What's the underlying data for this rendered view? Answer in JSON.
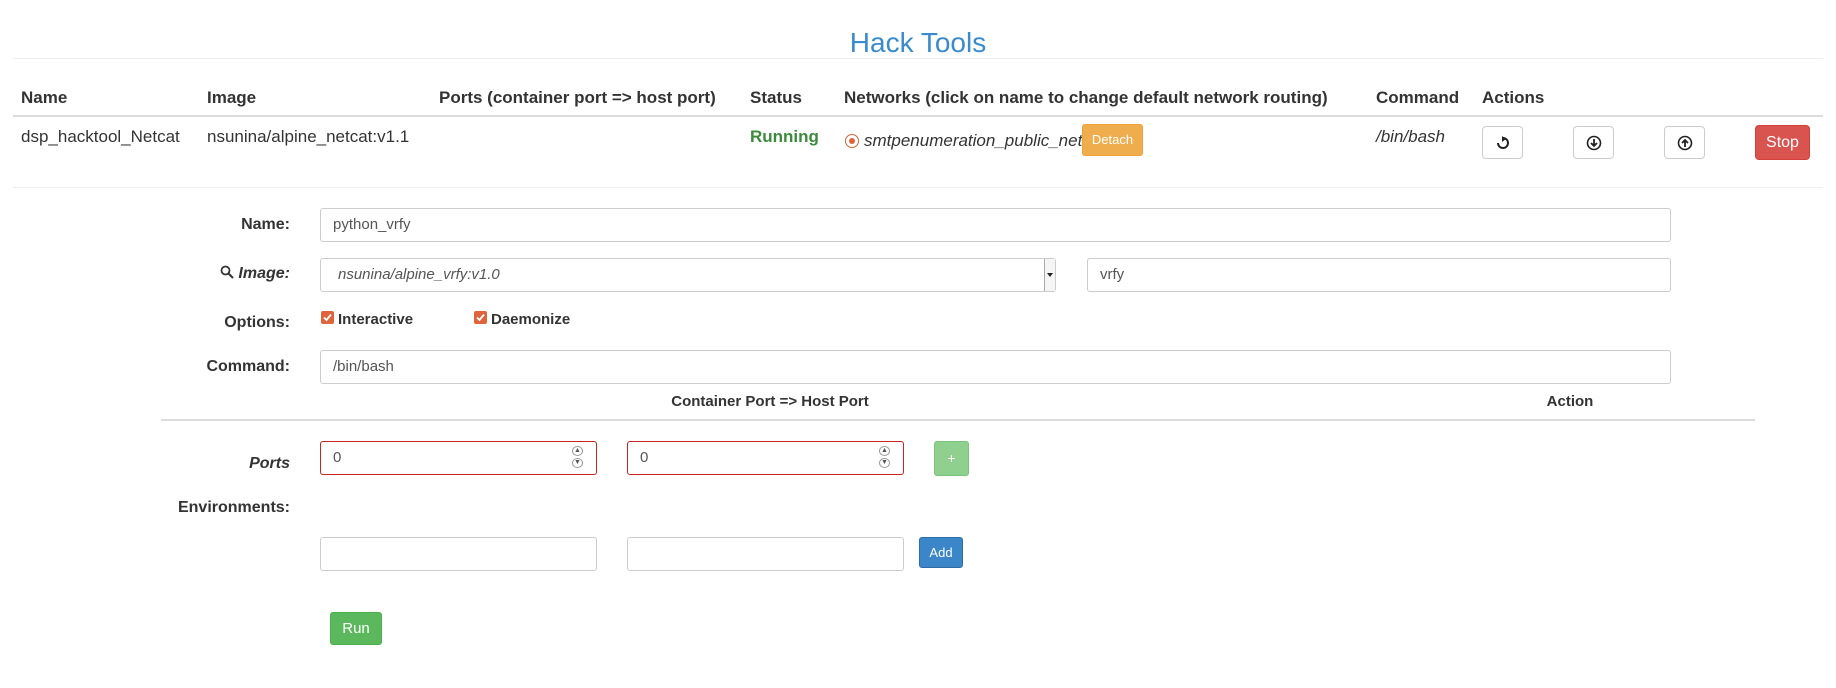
{
  "page": {
    "title": "Hack Tools"
  },
  "table": {
    "headers": {
      "name": "Name",
      "image": "Image",
      "ports": "Ports (container port => host port)",
      "status": "Status",
      "networks": "Networks (click on name to change default network routing)",
      "command": "Command",
      "actions": "Actions"
    },
    "rows": [
      {
        "name": "dsp_hacktool_Netcat",
        "image": "nsunina/alpine_netcat:v1.1",
        "ports": "",
        "status": "Running",
        "network": "smtpenumeration_public_network",
        "detach_label": "Detach",
        "command": "/bin/bash",
        "action_icons": [
          "open-shell-icon",
          "download-icon",
          "upload-icon"
        ],
        "stop_label": "Stop"
      }
    ]
  },
  "form": {
    "name_label": "Name:",
    "name_value": "python_vrfy",
    "image_label": "Image:",
    "image_selected": "nsunina/alpine_vrfy:v1.0",
    "image_search_value": "vrfy",
    "options_label": "Options:",
    "option_interactive": "Interactive",
    "option_daemonize": "Daemonize",
    "command_label": "Command:",
    "command_value": "/bin/bash",
    "ports_header": "Container Port => Host Port",
    "action_header": "Action",
    "ports_label": "Ports",
    "container_port_value": "0",
    "host_port_value": "0",
    "plus_label": "+",
    "environments_label": "Environments:",
    "env_key_value": "",
    "env_value_value": "",
    "add_label": "Add",
    "run_label": "Run"
  },
  "colors": {
    "title": "#3a8bcd",
    "running": "#3c8a3c",
    "detach": "#f0ad4e",
    "stop": "#d9534f",
    "run": "#5cb85c",
    "add": "#3a86c8",
    "checkbox": "#e0643b"
  }
}
